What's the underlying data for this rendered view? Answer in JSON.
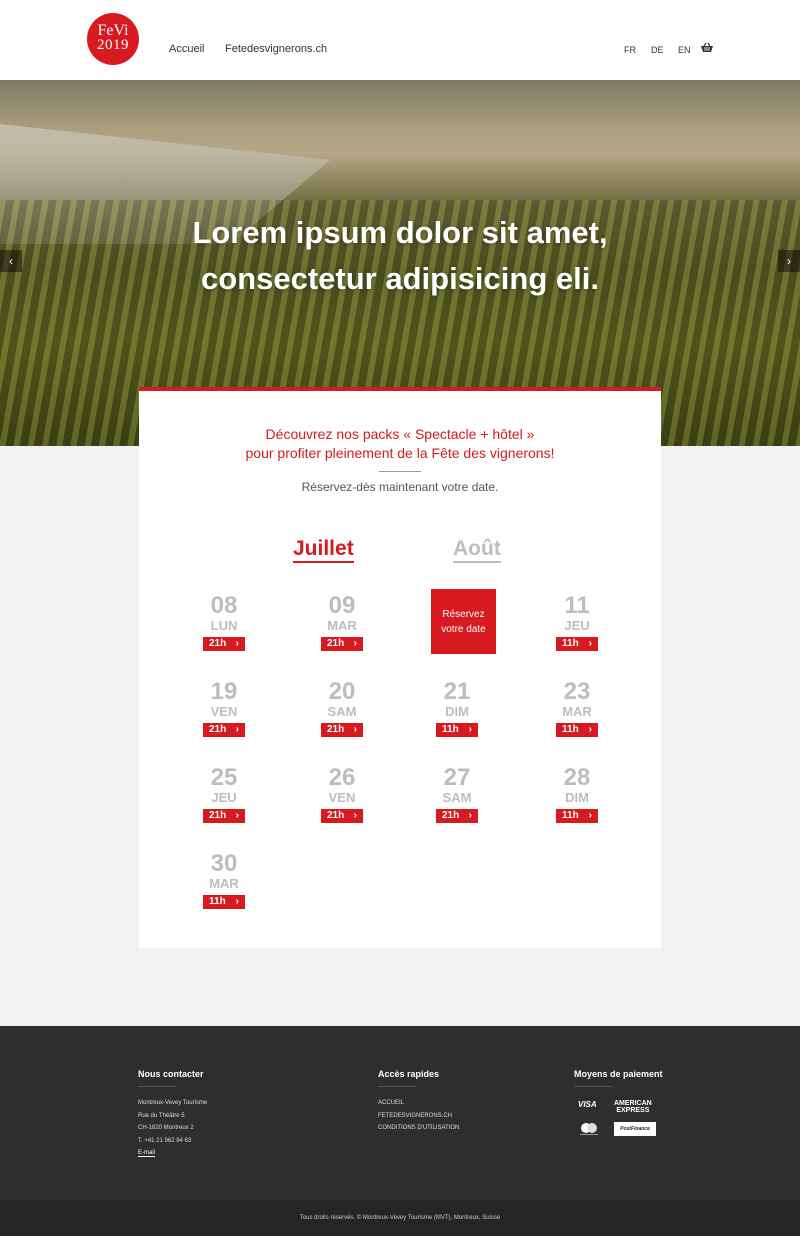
{
  "header": {
    "logo_line1": "FeVi",
    "logo_line2": "2019",
    "nav": [
      "Accueil",
      "Fetedesvignerons.ch"
    ],
    "languages": [
      "FR",
      "DE",
      "EN"
    ]
  },
  "hero": {
    "title_line1": "Lorem ipsum dolor sit amet,",
    "title_line2": "consectetur adipisicing eli.",
    "prev_arrow": "‹",
    "next_arrow": "›"
  },
  "booking": {
    "intro_line1": "Découvrez nos packs « Spectacle + hôtel »",
    "intro_line2": "pour profiter pleinement de la Fête des vignerons!",
    "subtitle": "Réservez-dès maintenant votre date.",
    "months": [
      "Juillet",
      "Août"
    ],
    "reserve_line1": "Réservez",
    "reserve_line2": "votre date",
    "days": [
      {
        "num": "08",
        "dow": "LUN",
        "time": "21h"
      },
      {
        "num": "09",
        "dow": "MAR",
        "time": "21h"
      },
      {
        "num": "11",
        "dow": "JEU",
        "time": "11h"
      },
      {
        "num": "19",
        "dow": "VEN",
        "time": "21h"
      },
      {
        "num": "20",
        "dow": "SAM",
        "time": "21h"
      },
      {
        "num": "21",
        "dow": "DIM",
        "time": "11h"
      },
      {
        "num": "23",
        "dow": "MAR",
        "time": "11h"
      },
      {
        "num": "25",
        "dow": "JEU",
        "time": "21h"
      },
      {
        "num": "26",
        "dow": "VEN",
        "time": "21h"
      },
      {
        "num": "27",
        "dow": "SAM",
        "time": "21h"
      },
      {
        "num": "28",
        "dow": "DIM",
        "time": "11h"
      },
      {
        "num": "30",
        "dow": "MAR",
        "time": "11h"
      }
    ],
    "chevron": "›"
  },
  "footer": {
    "contact_title": "Nous contacter",
    "contact_lines": [
      "Montreux-Vevey Tourisme",
      "Rue du Théâtre 5",
      "CH-1820 Montreux 2",
      "T. +41 21 962 84 63"
    ],
    "email_label": "E-mail",
    "quick_title": "Accès rapides",
    "quick_links": [
      "ACCUEIL",
      "FETEDESVIGNERONS.CH",
      "CONDITIONS D'UTILISATION"
    ],
    "payment_title": "Moyens de paiement",
    "payment_visa": "VISA",
    "payment_amex_1": "AMERICAN",
    "payment_amex_2": "EXPRESS",
    "payment_postfinance": "PostFinance",
    "copyright": "Tous droits réservés. © Montreux-Vevey Tourisme (MVT), Montreux, Suisse"
  },
  "colors": {
    "brand_red": "#d71920",
    "footer_bg": "#2e2e2e",
    "inactive_grey": "#bdbdbd"
  }
}
